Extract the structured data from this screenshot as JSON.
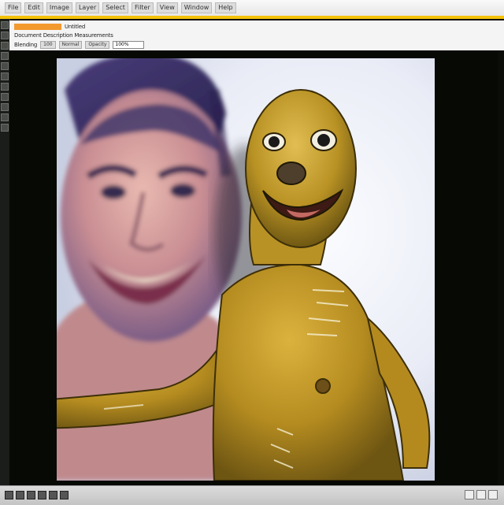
{
  "menubar": {
    "items": [
      "File",
      "Edit",
      "Image",
      "Layer",
      "Select",
      "Filter",
      "View",
      "Window",
      "Help"
    ],
    "right_label": ""
  },
  "toolbar": {
    "row1_text": "Untitled",
    "row2_text": "Document Description Measurements",
    "row3_label": "Blending",
    "row3_chips": [
      "100",
      "Normal",
      "Opacity"
    ],
    "row3_field": "100%"
  },
  "status": {
    "text": ""
  },
  "colors": {
    "accent_yellow": "#f3c20a",
    "accent_orange": "#f29a2e",
    "canvas_bg": "#070905"
  },
  "icons": {
    "left_tools": [
      "move-icon",
      "marquee-icon",
      "lasso-icon",
      "crop-icon",
      "brush-icon",
      "eraser-icon",
      "gradient-icon",
      "text-icon",
      "pen-icon",
      "hand-icon",
      "zoom-icon"
    ]
  }
}
